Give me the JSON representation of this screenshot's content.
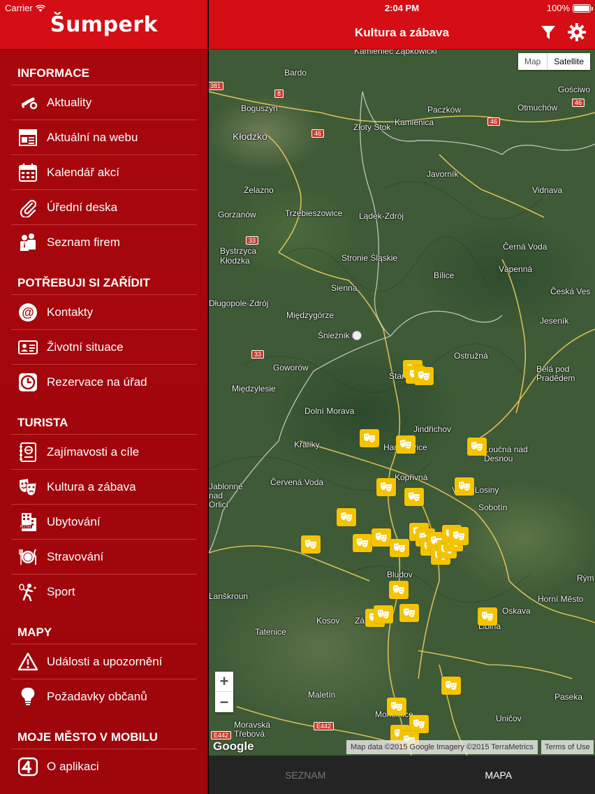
{
  "status": {
    "carrier": "Carrier",
    "time": "2:04 PM",
    "battery": "100%"
  },
  "app": {
    "logo": "Šumperk",
    "page_title": "Kultura a zábava"
  },
  "sidebar": {
    "sections": [
      {
        "title": "INFORMACE",
        "items": [
          {
            "label": "Aktuality",
            "icon": "horn-icon"
          },
          {
            "label": "Aktuální na webu",
            "icon": "news-icon"
          },
          {
            "label": "Kalendář akcí",
            "icon": "calendar-icon"
          },
          {
            "label": "Úřední deska",
            "icon": "paperclip-icon"
          },
          {
            "label": "Seznam firem",
            "icon": "business-people-icon"
          }
        ]
      },
      {
        "title": "POTŘEBUJI SI ZAŘÍDIT",
        "items": [
          {
            "label": "Kontakty",
            "icon": "at-icon"
          },
          {
            "label": "Životní situace",
            "icon": "id-card-icon"
          },
          {
            "label": "Rezervace na úřad",
            "icon": "clock-icon"
          }
        ]
      },
      {
        "title": "TURISTA",
        "items": [
          {
            "label": "Zajímavosti a cíle",
            "icon": "guidebook-icon"
          },
          {
            "label": "Kultura a zábava",
            "icon": "theater-masks-icon"
          },
          {
            "label": "Ubytování",
            "icon": "hotel-icon"
          },
          {
            "label": "Stravování",
            "icon": "plate-cutlery-icon"
          },
          {
            "label": "Sport",
            "icon": "tennis-icon"
          }
        ]
      },
      {
        "title": "MAPY",
        "items": [
          {
            "label": "Události a upozornění",
            "icon": "warning-icon"
          },
          {
            "label": "Požadavky občanů",
            "icon": "lightbulb-icon"
          }
        ]
      },
      {
        "title": "MOJE MĚSTO V MOBILU",
        "items": [
          {
            "label": "O aplikaci",
            "icon": "app-4-icon"
          }
        ]
      }
    ]
  },
  "map": {
    "type_map": "Map",
    "type_satellite": "Satellite",
    "zoom_in": "+",
    "zoom_out": "−",
    "google": "Google",
    "attribution": "Map data ©2015 Google Imagery ©2015 TerraMetrics",
    "terms": "Terms of Use",
    "labels": [
      "Kamieniec Ząbkowicki",
      "Bardo",
      "Gościwo",
      "Boguszyn",
      "Paczków",
      "Otmuchów",
      "Kłodzko",
      "Złoty Stok",
      "Kamienica",
      "Javorník",
      "Żelazno",
      "Vidnava",
      "Gorzanów",
      "Trzebieszowice",
      "Lądek-Zdrój",
      "Bystrzyca Kłodzka",
      "Stronie Śląskie",
      "Černá Voda",
      "Vápenná",
      "Bílice",
      "Sienna",
      "Česká Ves",
      "Długopole-Zdrój",
      "Międzygórze",
      "Jeseník",
      "Śnieżnik",
      "Ostružná",
      "Goworów",
      "Staré Město",
      "Bělá pod Pradědem",
      "Międzylesie",
      "Dolní Morava",
      "Jindřichov",
      "Králíky",
      "Hanušovice",
      "Loučná nad Desnou",
      "Červená Voda",
      "Kopřivná",
      "Velké Losiny",
      "Jablonné nad Orlicí",
      "Sobotín",
      "Bludov",
      "Rým",
      "Lanškroun",
      "Horní Město",
      "Kosov",
      "Zábřeh",
      "Oskava",
      "Tatenice",
      "Libina",
      "Maletín",
      "Paseka",
      "Moravská Třebová",
      "Uničov",
      "Mohelnice"
    ],
    "road_signs": [
      "381",
      "8",
      "46",
      "46",
      "46",
      "33",
      "33",
      "E442",
      "E442"
    ]
  },
  "tabs": [
    {
      "label": "SEZNAM",
      "active": false
    },
    {
      "label": "MAPA",
      "active": true
    }
  ],
  "colors": {
    "header_red": "#d40e14",
    "sidebar_red": "#a8070d",
    "marker_yellow": "#f5c400"
  }
}
